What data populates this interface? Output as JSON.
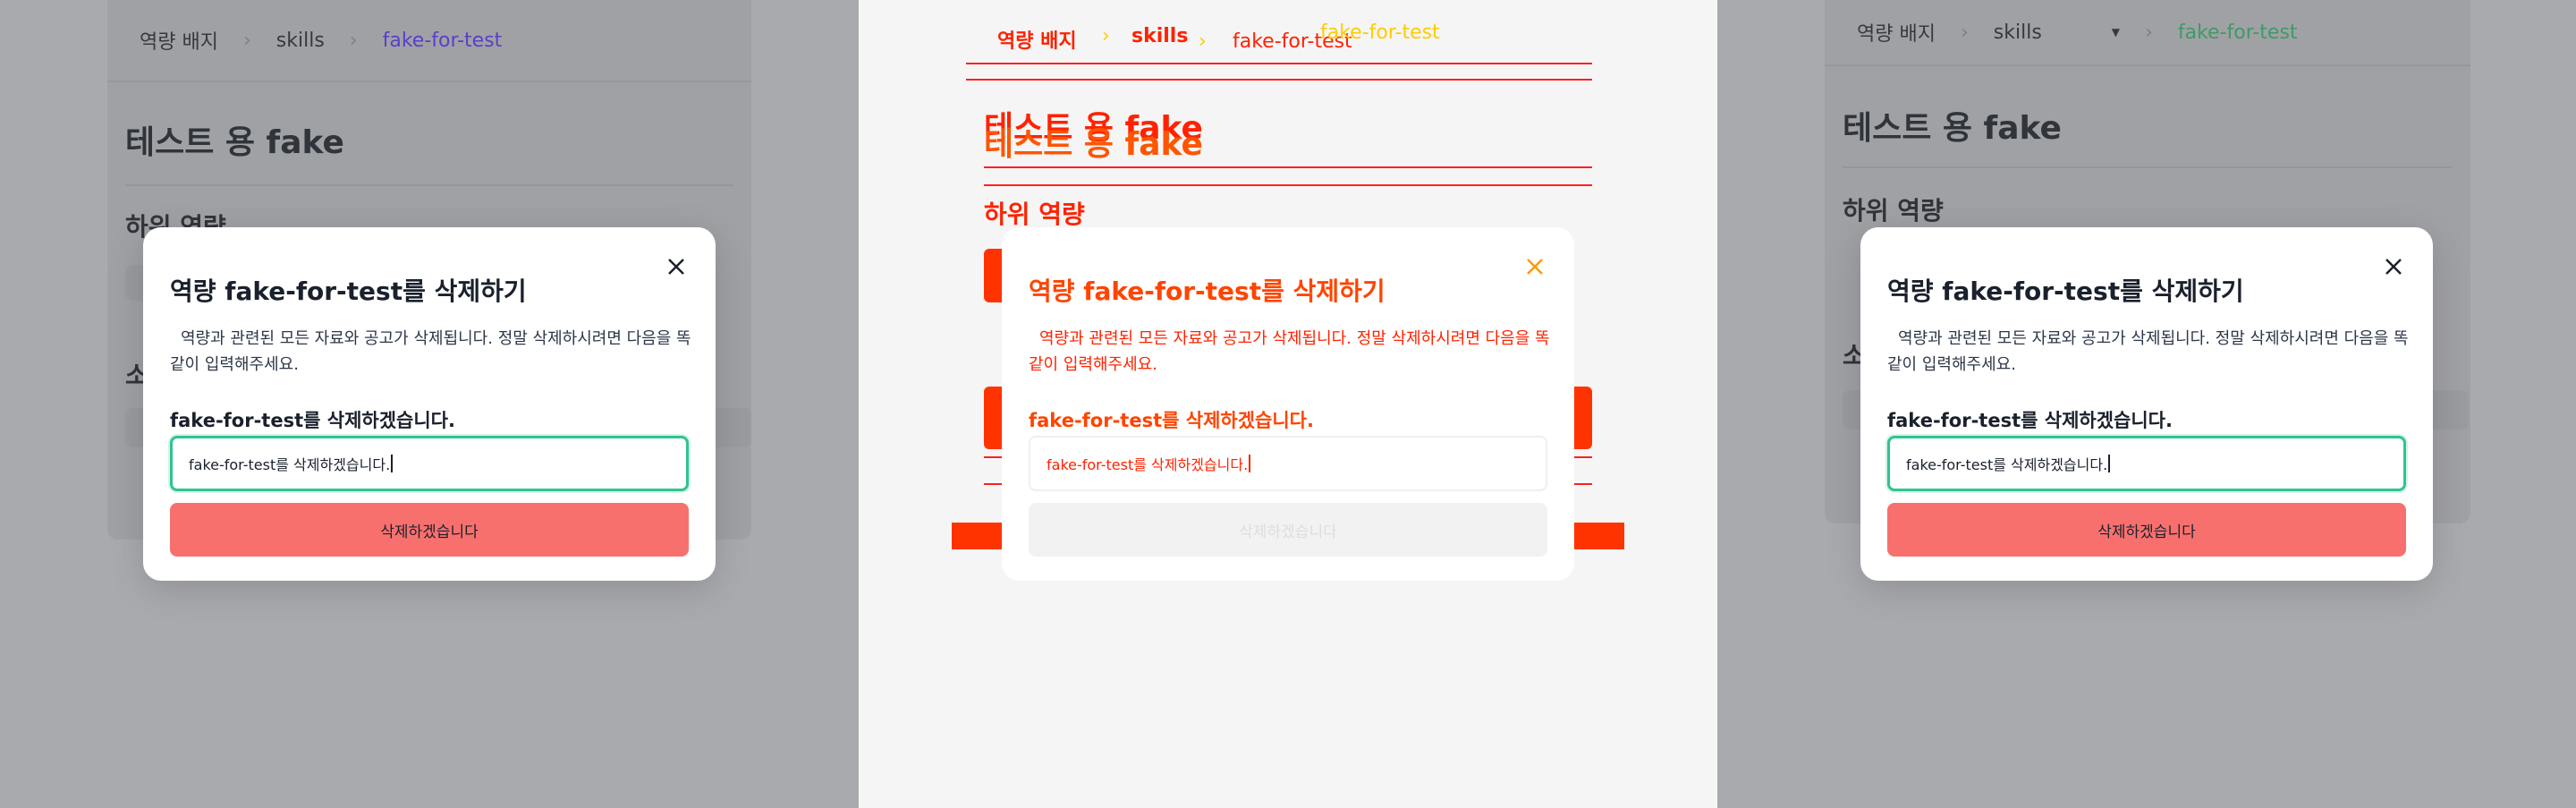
{
  "breadcrumb": {
    "root": "역량 배지",
    "mid": "skills",
    "current": "fake-for-test"
  },
  "page": {
    "title": "테스트 용 fake",
    "section_sub": "하위 역량",
    "section_partial": "소"
  },
  "modal": {
    "title": "역량 fake-for-test를 삭제하기",
    "description": "역량과 관련된 모든 자료와 공고가 삭제됩니다. 정말 삭제하시려면 다음을 똑같이 입력해주세요.",
    "confirm_label": "fake-for-test를 삭제하겠습니다.",
    "input_value": "fake-for-test를 삭제하겠습니다.",
    "submit": "삭제하겠습니다"
  },
  "colors": {
    "danger": "#f8706e",
    "focus": "#31c48d",
    "link": "#5a3fc7",
    "link_alt": "#3f9a66"
  },
  "icons": {
    "close": "close-icon",
    "separator": "chevron-right-icon",
    "dropdown": "caret-down-icon"
  }
}
